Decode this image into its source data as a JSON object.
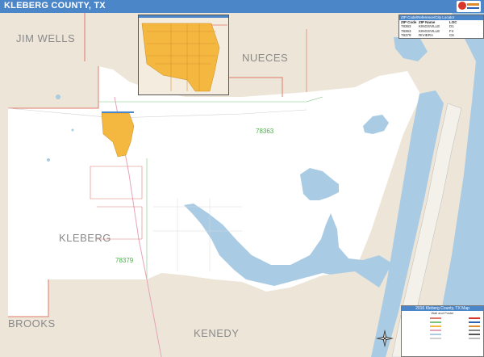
{
  "title": "KLEBERG COUNTY, TX",
  "counties": {
    "jim_wells": "JIM WELLS",
    "nueces": "NUECES",
    "kleberg": "KLEBERG",
    "brooks": "BROOKS",
    "kenedy": "KENEDY"
  },
  "zip_labels": {
    "z1": "78363",
    "z2": "78379"
  },
  "zip_table": {
    "title": "ZIP Code/Reference/City Locator",
    "headers": [
      "ZIP Code",
      "ZIP Name",
      "LOC"
    ],
    "rows": [
      [
        "78363",
        "KINGSVILLE",
        "D1"
      ],
      [
        "78363",
        "KINGSVILLE",
        "F4"
      ],
      [
        "78379",
        "RIVIERA",
        "C6"
      ]
    ]
  },
  "legend": {
    "title": "2016 Kleberg County, TX Map",
    "subtitle": "Wall and Poster"
  },
  "colors": {
    "title_bar": "#4a86c8",
    "land_outside": "#ece5d8",
    "county_land": "#ffffff",
    "water": "#a9cbe4",
    "city": "#f4b740",
    "county_border": "#e07a6a",
    "zip_border": "#7cc47c",
    "road": "#e6a3b6"
  },
  "icons": {
    "compass": "compass-rose-icon",
    "logo": "publisher-logo-icon"
  }
}
